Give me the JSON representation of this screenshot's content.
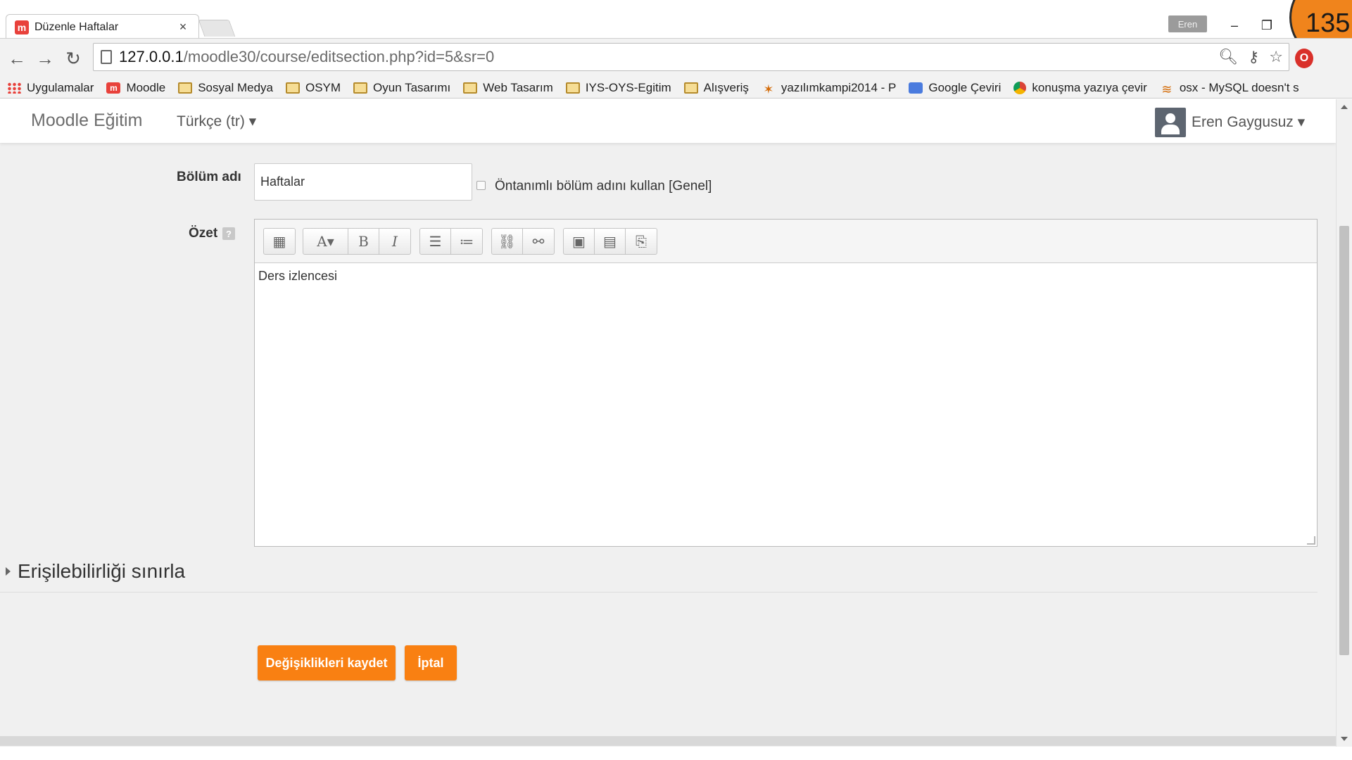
{
  "browser": {
    "tab_title": "Düzenle Haftalar",
    "tab_favicon": "m",
    "tab_close": "×",
    "profile_name": "Eren",
    "slide_number": "135",
    "url_host": "127.0.0.1",
    "url_path": "/moodle30/course/editsection.php?id=5&sr=0",
    "ext_icon": "O",
    "bookmarks": [
      {
        "label": "Uygulamalar",
        "icon": "apps-grid-icon"
      },
      {
        "label": "Moodle",
        "icon": "moodle-icon"
      },
      {
        "label": "Sosyal Medya",
        "icon": "folder-icon"
      },
      {
        "label": "OSYM",
        "icon": "folder-icon"
      },
      {
        "label": "Oyun Tasarımı",
        "icon": "folder-icon"
      },
      {
        "label": "Web Tasarım",
        "icon": "folder-icon"
      },
      {
        "label": "IYS-OYS-Egitim",
        "icon": "folder-icon"
      },
      {
        "label": "Alışveriş",
        "icon": "folder-icon"
      },
      {
        "label": "yazılımkampi2014 - P",
        "icon": "leopard-icon"
      },
      {
        "label": "Google Çeviri",
        "icon": "google-translate-icon"
      },
      {
        "label": "konuşma yazıya çevir",
        "icon": "chrome-icon"
      },
      {
        "label": "osx - MySQL doesn't s",
        "icon": "stackoverflow-icon"
      }
    ]
  },
  "navbar": {
    "brand": "Moodle Eğitim",
    "language": "Türkçe (tr) ▾",
    "user_name": "Eren Gaygusuz ▾"
  },
  "form": {
    "section_name_label": "Bölüm adı",
    "section_name_value": "Haftalar",
    "default_name_checkbox_label": "Öntanımlı bölüm adını kullan [Genel]",
    "summary_label": "Özet",
    "help_glyph": "?",
    "summary_text": "Ders izlencesi",
    "restrict_access_title": "Erişilebilirliği sınırla",
    "save_button": "Değişiklikleri kaydet",
    "cancel_button": "İptal"
  },
  "editor_toolbar": {
    "groups": [
      [
        "toggle-toolbar-icon"
      ],
      [
        "font-style-icon",
        "bold-icon",
        "italic-icon"
      ],
      [
        "unordered-list-icon",
        "ordered-list-icon"
      ],
      [
        "link-icon",
        "unlink-icon"
      ],
      [
        "image-icon",
        "media-icon",
        "manage-files-icon"
      ]
    ]
  },
  "colors": {
    "accent_orange": "#f98012",
    "moodle_red": "#e8413b",
    "page_bg": "#f0f0f0"
  }
}
